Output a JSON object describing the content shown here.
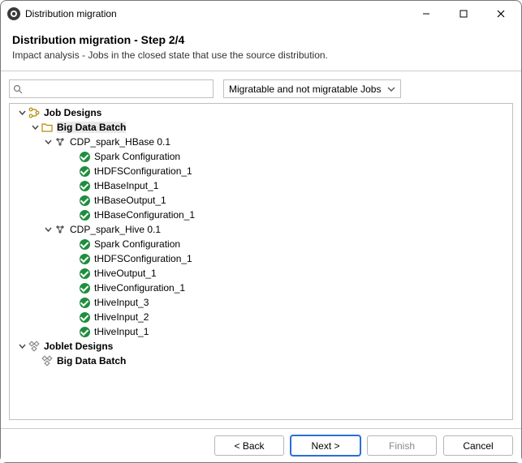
{
  "window": {
    "title": "Distribution migration"
  },
  "header": {
    "title": "Distribution migration - Step 2/4",
    "subtitle": "Impact analysis - Jobs in the closed state that use the source distribution."
  },
  "filters": {
    "search_placeholder": "",
    "combo_value": "Migratable and not migratable Jobs"
  },
  "tree": [
    {
      "indent": 0,
      "toggle": "open",
      "icon": "branch-icon",
      "label": "Job Designs",
      "bold": true
    },
    {
      "indent": 1,
      "toggle": "open",
      "icon": "folder-icon",
      "label": "Big Data Batch",
      "bold": true,
      "selected": true
    },
    {
      "indent": 2,
      "toggle": "open",
      "icon": "job-icon",
      "label": "CDP_spark_HBase 0.1"
    },
    {
      "indent": 3,
      "toggle": "blank",
      "icon": "check-icon",
      "label": "Spark Configuration"
    },
    {
      "indent": 3,
      "toggle": "blank",
      "icon": "check-icon",
      "label": "tHDFSConfiguration_1"
    },
    {
      "indent": 3,
      "toggle": "blank",
      "icon": "check-icon",
      "label": "tHBaseInput_1"
    },
    {
      "indent": 3,
      "toggle": "blank",
      "icon": "check-icon",
      "label": "tHBaseOutput_1"
    },
    {
      "indent": 3,
      "toggle": "blank",
      "icon": "check-icon",
      "label": "tHBaseConfiguration_1"
    },
    {
      "indent": 2,
      "toggle": "open",
      "icon": "job-icon",
      "label": "CDP_spark_Hive 0.1"
    },
    {
      "indent": 3,
      "toggle": "blank",
      "icon": "check-icon",
      "label": "Spark Configuration"
    },
    {
      "indent": 3,
      "toggle": "blank",
      "icon": "check-icon",
      "label": "tHDFSConfiguration_1"
    },
    {
      "indent": 3,
      "toggle": "blank",
      "icon": "check-icon",
      "label": "tHiveOutput_1"
    },
    {
      "indent": 3,
      "toggle": "blank",
      "icon": "check-icon",
      "label": "tHiveConfiguration_1"
    },
    {
      "indent": 3,
      "toggle": "blank",
      "icon": "check-icon",
      "label": "tHiveInput_3"
    },
    {
      "indent": 3,
      "toggle": "blank",
      "icon": "check-icon",
      "label": "tHiveInput_2"
    },
    {
      "indent": 3,
      "toggle": "blank",
      "icon": "check-icon",
      "label": "tHiveInput_1"
    },
    {
      "indent": 0,
      "toggle": "open",
      "icon": "joblet-icon",
      "label": "Joblet Designs",
      "bold": true
    },
    {
      "indent": 1,
      "toggle": "blank",
      "icon": "joblet-icon",
      "label": "Big Data Batch",
      "bold": true
    }
  ],
  "footer": {
    "back": "< Back",
    "next": "Next >",
    "finish": "Finish",
    "cancel": "Cancel"
  }
}
